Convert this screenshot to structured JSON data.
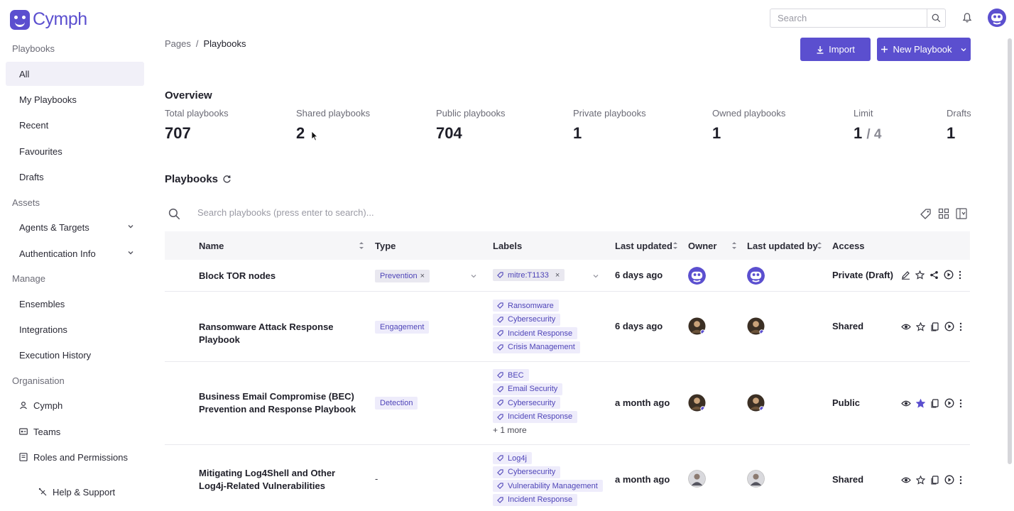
{
  "app": {
    "name": "Cymph"
  },
  "search": {
    "placeholder": "Search"
  },
  "sidebar": {
    "sections": {
      "playbooks": "Playbooks",
      "assets": "Assets",
      "manage": "Manage",
      "organisation": "Organisation"
    },
    "items": {
      "all": "All",
      "my_playbooks": "My Playbooks",
      "recent": "Recent",
      "favourites": "Favourites",
      "drafts": "Drafts",
      "agents_targets": "Agents & Targets",
      "authentication_info": "Authentication Info",
      "ensembles": "Ensembles",
      "integrations": "Integrations",
      "execution_history": "Execution History",
      "cymph": "Cymph",
      "teams": "Teams",
      "roles_permissions": "Roles and Permissions"
    },
    "help": "Help & Support"
  },
  "breadcrumb": {
    "parent": "Pages",
    "separator": "/",
    "current": "Playbooks"
  },
  "buttons": {
    "import": "Import",
    "new_playbook": "New Playbook"
  },
  "overview": {
    "title": "Overview",
    "stats": {
      "total": {
        "label": "Total playbooks",
        "value": "707"
      },
      "shared": {
        "label": "Shared playbooks",
        "value": "2"
      },
      "public": {
        "label": "Public playbooks",
        "value": "704"
      },
      "private": {
        "label": "Private playbooks",
        "value": "1"
      },
      "owned": {
        "label": "Owned playbooks",
        "value": "1"
      },
      "limit": {
        "label": "Limit",
        "value": "1",
        "total": "/ 4"
      },
      "drafts": {
        "label": "Drafts",
        "value": "1"
      }
    }
  },
  "playbooks_section": {
    "title": "Playbooks",
    "search_placeholder": "Search playbooks (press enter to search)..."
  },
  "table": {
    "columns": {
      "name": "Name",
      "type": "Type",
      "labels": "Labels",
      "last_updated": "Last updated",
      "owner": "Owner",
      "last_updated_by": "Last updated by",
      "access": "Access"
    },
    "rows": [
      {
        "name": "Block TOR nodes",
        "type": "Prevention",
        "labels": [
          "mitre:T1133"
        ],
        "more": "",
        "last_updated": "6 days ago",
        "access": "Private (Draft)",
        "favourite": false
      },
      {
        "name": "Ransomware Attack Response Playbook",
        "type": "Engagement",
        "labels": [
          "Ransomware",
          "Cybersecurity",
          "Incident Response",
          "Crisis Management"
        ],
        "more": "",
        "last_updated": "6 days ago",
        "access": "Shared",
        "favourite": false
      },
      {
        "name": "Business Email Compromise (BEC) Prevention and Response Playbook",
        "type": "Detection",
        "labels": [
          "BEC",
          "Email Security",
          "Cybersecurity",
          "Incident Response"
        ],
        "more": "+ 1 more",
        "last_updated": "a month ago",
        "access": "Public",
        "favourite": true
      },
      {
        "name": "Mitigating Log4Shell and Other Log4j-Related Vulnerabilities",
        "type": "-",
        "labels": [
          "Log4j",
          "Cybersecurity",
          "Vulnerability Management",
          "Incident Response"
        ],
        "more": "",
        "last_updated": "a month ago",
        "access": "Shared",
        "favourite": false
      }
    ]
  },
  "colors": {
    "accent": "#5b4fcf",
    "chip_bg": "#eeecfb",
    "chip_text": "#4f45b8",
    "star": "#5b4fcf"
  }
}
